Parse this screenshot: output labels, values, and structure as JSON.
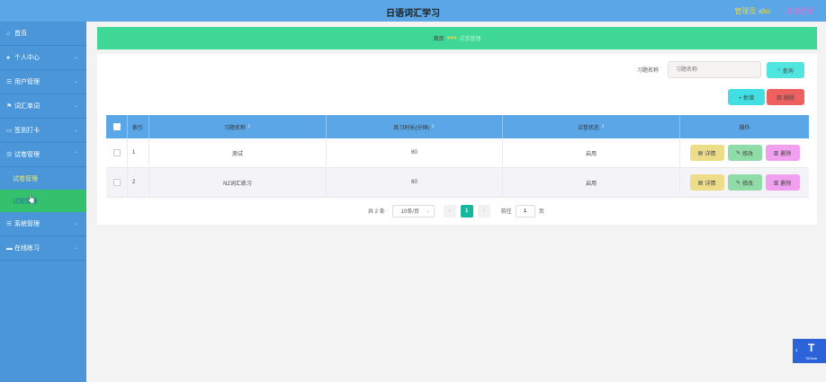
{
  "header": {
    "title": "日语词汇学习",
    "admin": "管理员 abo",
    "logout": "退出登录"
  },
  "sidebar": {
    "items": [
      {
        "label": "首页",
        "icon": "home-icon"
      },
      {
        "label": "个人中心",
        "icon": "user-icon"
      },
      {
        "label": "用户管理",
        "icon": "users-icon"
      },
      {
        "label": "词汇单词",
        "icon": "flag-icon"
      },
      {
        "label": "签到打卡",
        "icon": "calendar-icon"
      },
      {
        "label": "试卷管理",
        "icon": "list-icon"
      }
    ],
    "subitems": [
      {
        "label": "试卷管理"
      },
      {
        "label": "试题管理"
      }
    ],
    "items_after": [
      {
        "label": "系统管理",
        "icon": "settings-icon"
      },
      {
        "label": "在线练习",
        "icon": "chat-icon"
      }
    ]
  },
  "breadcrumb": {
    "home": "首页",
    "hearts": "♥♥♥",
    "current": "试卷管理"
  },
  "search": {
    "label": "习题名称",
    "placeholder": "习题名称",
    "button": "查询"
  },
  "actions": {
    "add": "+ 新增",
    "delete": "删除"
  },
  "table": {
    "headers": {
      "index": "索引",
      "name": "习题名称",
      "length": "练习时长(分钟)",
      "status": "试卷状态",
      "ops": "操作"
    },
    "rows": [
      {
        "index": "1",
        "name": "测试",
        "length": "60",
        "status": "启用"
      },
      {
        "index": "2",
        "name": "N2词汇练习",
        "length": "60",
        "status": "启用"
      }
    ],
    "ops": {
      "detail": "详情",
      "edit": "修改",
      "delete": "删除"
    }
  },
  "pagination": {
    "total": "共 2 条",
    "page_size": "10条/页",
    "current": "1",
    "goto_prefix": "前往",
    "goto_value": "1",
    "goto_suffix": "页"
  },
  "todesk": {
    "label": "ToDesk"
  }
}
